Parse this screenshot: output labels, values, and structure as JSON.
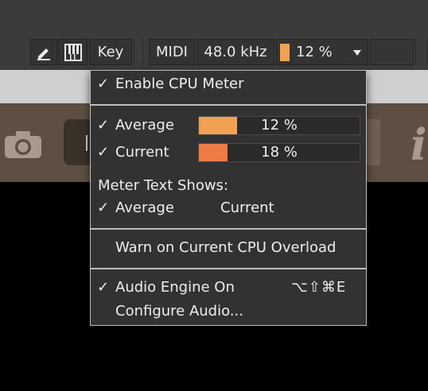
{
  "toolbar": {
    "key_label": "Key",
    "midi_label": "MIDI",
    "sample_rate": "48.0 kHz",
    "cpu_percent": "12 %",
    "cpu_color": "#f0a151"
  },
  "menu": {
    "enable_cpu_meter": {
      "label": "Enable CPU Meter",
      "checked": true
    },
    "average": {
      "label": "Average",
      "checked": true,
      "value_text": "12 %",
      "fill": 0.12,
      "color": "#f0a151"
    },
    "current": {
      "label": "Current",
      "checked": true,
      "value_text": "18 %",
      "fill": 0.18,
      "color": "#ee7d45"
    },
    "meter_text_heading": "Meter Text Shows:",
    "meter_text_options": [
      {
        "label": "Average",
        "checked": true
      },
      {
        "label": "Current",
        "checked": false
      }
    ],
    "warn_overload": {
      "label": "Warn on Current CPU Overload",
      "checked": false
    },
    "audio_engine": {
      "label": "Audio Engine On",
      "checked": true,
      "shortcut": "⌥⇧⌘E"
    },
    "configure_audio": {
      "label": "Configure Audio..."
    },
    "check_glyph": "✓"
  },
  "colors": {
    "menu_bg": "#323232",
    "menu_border": "#bdbdbd",
    "accent_orange": "#f0a151"
  }
}
